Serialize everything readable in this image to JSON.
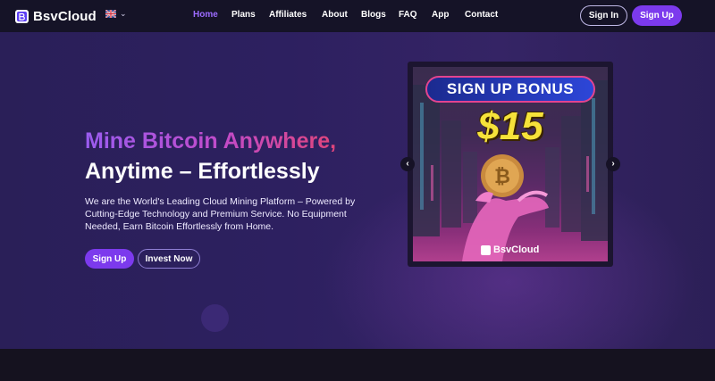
{
  "brand": {
    "name": "BsvCloud"
  },
  "nav": {
    "items": [
      {
        "label": "Home",
        "active": true
      },
      {
        "label": "Plans",
        "active": false
      },
      {
        "label": "Affiliates",
        "active": false
      },
      {
        "label": "About",
        "active": false
      },
      {
        "label": "Blogs",
        "active": false
      },
      {
        "label": "FAQ",
        "active": false
      },
      {
        "label": "App",
        "active": false
      },
      {
        "label": "Contact",
        "active": false
      }
    ],
    "sign_in": "Sign In",
    "sign_up": "Sign Up"
  },
  "language": {
    "flag": "uk-flag-icon"
  },
  "hero": {
    "headline_1": "Mine Bitcoin Anywhere,",
    "headline_2": "Anytime – Effortlessly",
    "description": "We are the World's Leading Cloud Mining Platform – Powered by Cutting-Edge Technology and Premium Service. No Equipment Needed, Earn Bitcoin Effortlessly from Home.",
    "cta_primary": "Sign Up",
    "cta_secondary": "Invest Now"
  },
  "banner": {
    "title": "SIGN UP BONUS",
    "amount": "$15",
    "brand": "BsvCloud"
  },
  "colors": {
    "accent": "#7c3aed",
    "nav_active": "#9c6cff",
    "background": "#16142a",
    "bonus_yellow": "#f6e23a"
  }
}
